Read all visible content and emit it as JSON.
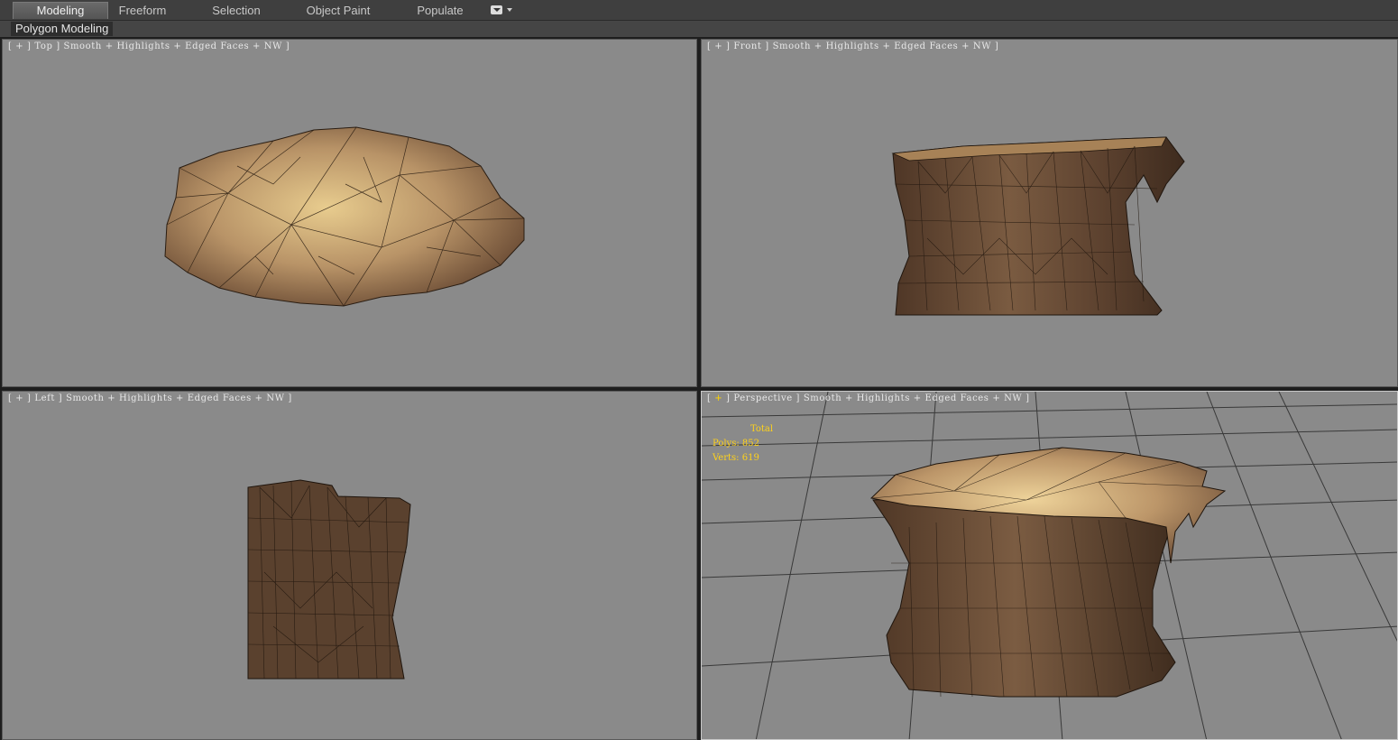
{
  "ribbon": {
    "tabs": [
      "Modeling",
      "Freeform",
      "Selection",
      "Object Paint",
      "Populate"
    ],
    "active_tab": "Modeling",
    "panel_label": "Polygon Modeling"
  },
  "viewports": [
    {
      "id": "top",
      "plus": "+",
      "view": "Top",
      "mode": "Smooth + Highlights + Edged Faces + NW"
    },
    {
      "id": "front",
      "plus": "+",
      "view": "Front",
      "mode": "Smooth + Highlights + Edged Faces + NW"
    },
    {
      "id": "left",
      "plus": "+",
      "view": "Left",
      "mode": "Smooth + Highlights + Edged Faces + NW"
    },
    {
      "id": "perspective",
      "plus": "+",
      "view": "Perspective",
      "mode": "Smooth + Highlights + Edged Faces + NW"
    }
  ],
  "stats": {
    "title": "Total",
    "polys_label": "Polys:",
    "polys": "852",
    "verts_label": "Verts:",
    "verts": "619"
  },
  "colors": {
    "viewport_bg": "#8a8a8a",
    "rock_dark": "#5b4230",
    "rock_light": "#c9a873",
    "highlight": "#ffd400",
    "stats_text": "#ffd21a"
  }
}
